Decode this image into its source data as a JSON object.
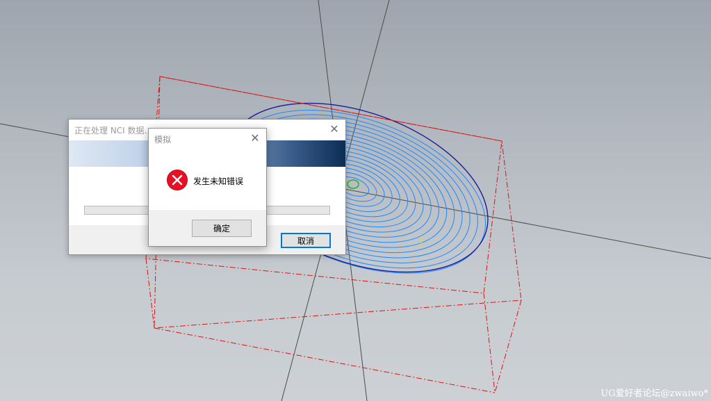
{
  "progress_dialog": {
    "title": "正在处理 NCI 数据...",
    "close_symbol": "✕",
    "cancel_label": "取消",
    "progress_fraction": 0
  },
  "error_dialog": {
    "title": "模拟",
    "close_symbol": "✕",
    "message": "发生未知错误",
    "ok_label": "确定",
    "icon": "error-icon"
  },
  "watermark": "UG爱好者论坛@zwaiwo*",
  "colors": {
    "bounding_box": "#e01010",
    "toolpath": "#1e88ff",
    "outline": "#1a1a9a",
    "axis": "#4a4a4a",
    "error_red": "#e81123",
    "focus_blue": "#0078d7"
  }
}
